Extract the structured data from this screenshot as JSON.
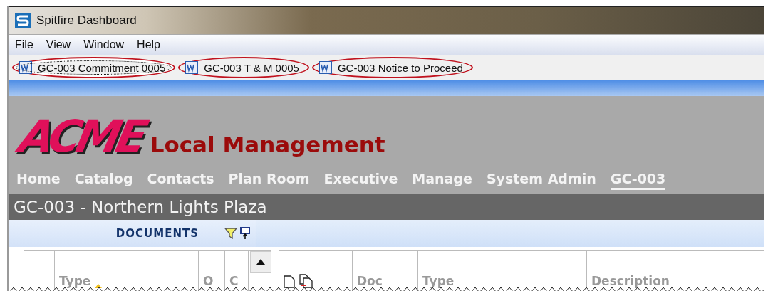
{
  "window": {
    "title": "Spitfire Dashboard"
  },
  "menu": [
    "File",
    "View",
    "Window",
    "Help"
  ],
  "document_tabs": [
    {
      "label": "GC-003 Commitment 0005",
      "selected": true
    },
    {
      "label": "GC-003 T & M 0005",
      "selected": false
    },
    {
      "label": "GC-003 Notice to Proceed",
      "selected": false
    }
  ],
  "header": {
    "logo": "ACME",
    "app_name": "Local Management"
  },
  "nav": [
    {
      "label": "Home",
      "selected": false
    },
    {
      "label": "Catalog",
      "selected": false
    },
    {
      "label": "Contacts",
      "selected": false
    },
    {
      "label": "Plan Room",
      "selected": false
    },
    {
      "label": "Executive",
      "selected": false
    },
    {
      "label": "Manage",
      "selected": false
    },
    {
      "label": "System Admin",
      "selected": false
    },
    {
      "label": "GC-003",
      "selected": true
    }
  ],
  "project_title": "GC-003 - Northern Lights Plaza",
  "documents_panel": {
    "title": "DOCUMENTS",
    "columns": [
      {
        "label": "Type",
        "sorted": true
      },
      {
        "label": "O",
        "sorted": false
      },
      {
        "label": "C",
        "sorted": false
      }
    ]
  },
  "grid": {
    "columns": [
      "Doc",
      "Type",
      "Description"
    ]
  }
}
